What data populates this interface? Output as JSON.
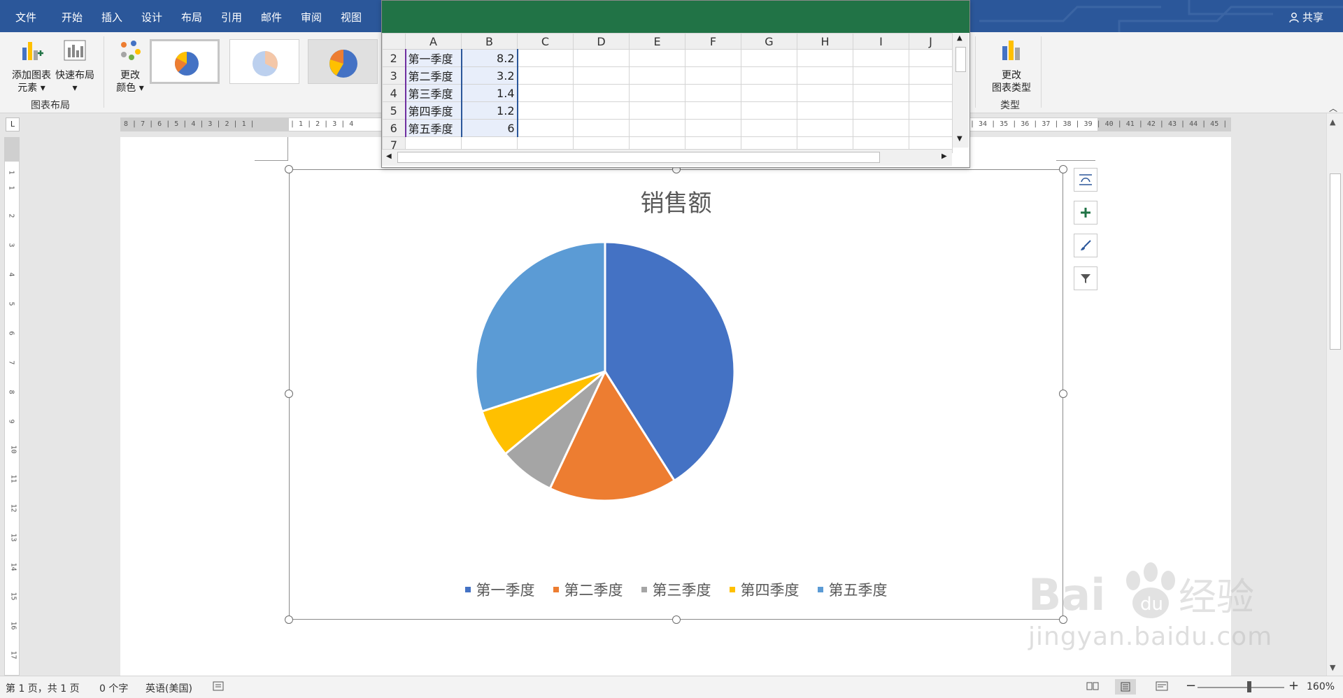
{
  "ribbon_tabs": [
    "文件",
    "开始",
    "插入",
    "设计",
    "布局",
    "引用",
    "邮件",
    "审阅",
    "视图"
  ],
  "share_label": "共享",
  "ribbon": {
    "add_chart_element_line1": "添加图表",
    "add_chart_element_line2": "元素",
    "quick_layout": "快速布局",
    "group_chart_layout": "图表布局",
    "change_colors_line1": "更改",
    "change_colors_line2": "颜色",
    "change_type_line1": "更改",
    "change_type_line2": "图表类型",
    "group_type": "类型"
  },
  "ruler_left_ticks": "8 | 7 | 6 | 5 | 4 | 3 | 2 | 1 |",
  "ruler_mid_ticks": "| 1 | 2 | 3 | 4",
  "ruler_right_ticks": "| 34 | 35 | 36 | 37 | 38 | 39 | 40 | 41 | 42 | 43 | 44 | 45 |",
  "vruler_ticks": [
    "1",
    "1",
    "2",
    "3",
    "4",
    "5",
    "6",
    "7",
    "8",
    "9",
    "10",
    "11",
    "12",
    "13",
    "14",
    "15",
    "16",
    "17"
  ],
  "ruler_corner": "L",
  "spreadsheet": {
    "column_headers": [
      "A",
      "B",
      "C",
      "D",
      "E",
      "F",
      "G",
      "H",
      "I",
      "J"
    ],
    "rows": [
      {
        "row": "2",
        "label": "第一季度",
        "value": "8.2"
      },
      {
        "row": "3",
        "label": "第二季度",
        "value": "3.2"
      },
      {
        "row": "4",
        "label": "第三季度",
        "value": "1.4"
      },
      {
        "row": "5",
        "label": "第四季度",
        "value": "1.2"
      },
      {
        "row": "6",
        "label": "第五季度",
        "value": "6"
      },
      {
        "row": "7",
        "label": "",
        "value": ""
      }
    ]
  },
  "chart_data": {
    "type": "pie",
    "title": "销售额",
    "categories": [
      "第一季度",
      "第二季度",
      "第三季度",
      "第四季度",
      "第五季度"
    ],
    "values": [
      8.2,
      3.2,
      1.4,
      1.2,
      6
    ],
    "colors": [
      "#4472c4",
      "#ed7d31",
      "#a5a5a5",
      "#ffc000",
      "#5b9bd5"
    ],
    "legend_position": "bottom"
  },
  "statusbar": {
    "page": "第 1 页，共 1 页",
    "words": "0 个字",
    "language": "英语(美国)",
    "zoom": "160%"
  },
  "watermark": {
    "text": "jingyan.baidu.com"
  }
}
